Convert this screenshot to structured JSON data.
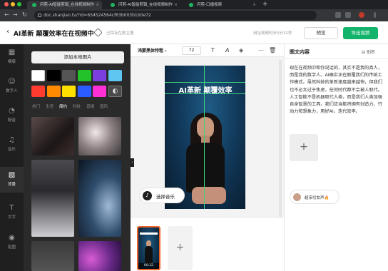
{
  "browser": {
    "tabs": [
      "闪剪-AI智能剪辑_在线视频制作",
      "闪剪-AI智能剪辑_在线视频制作",
      "闪剪-口播视频"
    ],
    "url": "doc.shanjian.tv/?id=654524564cf63b003b1b0e72"
  },
  "header": {
    "back_icon": "chevron-left-icon",
    "title": "AI革新 颠覆效率在在视频中",
    "save_status": "已保存在剧立据",
    "hint": "用址视频时分0分32秒",
    "preview_label": "预览",
    "export_label": "导出视频"
  },
  "rail": {
    "items": [
      {
        "label": "模版",
        "icon": "template-icon"
      },
      {
        "label": "数字人",
        "icon": "avatar-icon"
      },
      {
        "label": "配音",
        "icon": "voice-icon"
      },
      {
        "label": "音乐",
        "icon": "music-icon"
      },
      {
        "label": "背景",
        "icon": "background-icon",
        "active": true
      },
      {
        "label": "文字",
        "icon": "text-icon"
      },
      {
        "label": "贴图",
        "icon": "sticker-icon"
      }
    ]
  },
  "materials": {
    "add_bg_label": "添加本地图片",
    "swatches": [
      "#ffffff",
      "#000000",
      "#555555",
      "#22c22a",
      "#7b3fe0",
      "#5ec6f0",
      "#ff3b30",
      "#ff8a00",
      "#ffe100",
      "#2b5cff",
      "#ff2fd6"
    ],
    "filters": [
      "热门",
      "生活",
      "简约",
      "科技",
      "直播",
      "国风"
    ],
    "active_filter": "简约"
  },
  "editor": {
    "font_name": "鸿蒙黑体特粗",
    "font_size": "72",
    "overlay_text": "AI革新 颠覆效率",
    "music_label": "选择音乐",
    "clip_duration": "00:32"
  },
  "right_panel": {
    "title": "图文内容",
    "rename_label": "别名",
    "script": "现在在视频中和你说话的，其实不是我的真人，而是我的数字人。AI确实正在颠覆我们的传统工作模式。虽然科技的革新速度越来越快，但我们也不必太过于焦虑，任何时代都不会被人取代。人工智能不是机器取代人类，而是我们人类加强自身智慧的工具，我们应当能将拥有创造力、行动力和想象力，用好AI，迭代效率。",
    "voice_label": "超亲切女声🔥"
  }
}
